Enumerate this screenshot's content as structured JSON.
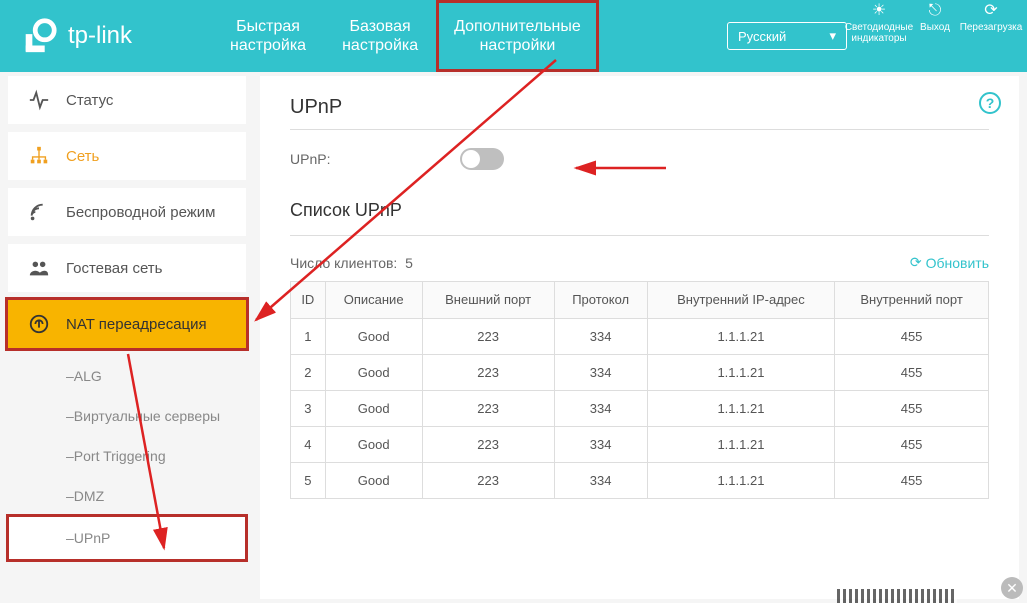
{
  "brand": "tp-link",
  "header": {
    "tabs": [
      {
        "line1": "Быстрая",
        "line2": "настройка"
      },
      {
        "line1": "Базовая",
        "line2": "настройка"
      },
      {
        "line1": "Дополнительные",
        "line2": "настройки"
      }
    ],
    "language": "Русский",
    "icons": {
      "leds": "Светодиодные индикаторы",
      "logout": "Выход",
      "reboot": "Перезагрузка"
    }
  },
  "sidebar": {
    "status": "Статус",
    "network": "Сеть",
    "wireless": "Беспроводной режим",
    "guest": "Гостевая сеть",
    "nat": "NAT переадресация",
    "sub": {
      "alg": "ALG",
      "vservers": "Виртуальные серверы",
      "porttrig": "Port Triggering",
      "dmz": "DMZ",
      "upnp": "UPnP"
    }
  },
  "content": {
    "title": "UPnP",
    "upnp_label": "UPnP:",
    "list_title": "Список UPnP",
    "clients_label": "Число клиентов:",
    "clients_count": "5",
    "refresh": "Обновить",
    "columns": {
      "id": "ID",
      "desc": "Описание",
      "ext_port": "Внешний порт",
      "proto": "Протокол",
      "int_ip": "Внутренний IP-адрес",
      "int_port": "Внутренний порт"
    },
    "rows": [
      {
        "id": "1",
        "desc": "Good",
        "ext_port": "223",
        "proto": "334",
        "int_ip": "1.1.1.21",
        "int_port": "455"
      },
      {
        "id": "2",
        "desc": "Good",
        "ext_port": "223",
        "proto": "334",
        "int_ip": "1.1.1.21",
        "int_port": "455"
      },
      {
        "id": "3",
        "desc": "Good",
        "ext_port": "223",
        "proto": "334",
        "int_ip": "1.1.1.21",
        "int_port": "455"
      },
      {
        "id": "4",
        "desc": "Good",
        "ext_port": "223",
        "proto": "334",
        "int_ip": "1.1.1.21",
        "int_port": "455"
      },
      {
        "id": "5",
        "desc": "Good",
        "ext_port": "223",
        "proto": "334",
        "int_ip": "1.1.1.21",
        "int_port": "455"
      }
    ]
  }
}
